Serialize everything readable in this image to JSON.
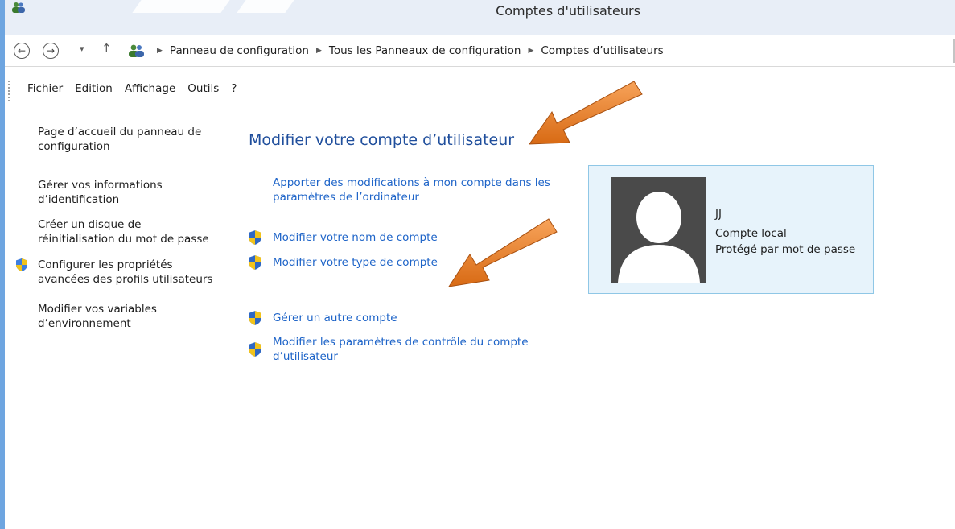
{
  "window": {
    "title": "Comptes d'utilisateurs"
  },
  "address": {
    "breadcrumbs": [
      "Panneau de configuration",
      "Tous les Panneaux de configuration",
      "Comptes d’utilisateurs"
    ]
  },
  "menu": [
    "Fichier",
    "Edition",
    "Affichage",
    "Outils",
    "?"
  ],
  "left_panel": {
    "home_line1": "Page d’accueil du panneau de",
    "home_line2": "configuration",
    "ident_line1": "Gérer vos informations",
    "ident_line2": "d’identification",
    "reset_line1": "Créer un disque de",
    "reset_line2": "réinitialisation du mot de passe",
    "profiles_line1": "Configurer les propriétés",
    "profiles_line2": "avancées des profils utilisateurs",
    "env_line1": "Modifier vos variables",
    "env_line2": "d’environnement"
  },
  "main": {
    "title": "Modifier votre compte d’utilisateur",
    "settings_line1": "Apporter des modifications à mon compte dans les",
    "settings_line2": "paramètres de l’ordinateur",
    "rename": "Modifier votre nom de compte",
    "change_type": "Modifier votre type de compte",
    "manage_other": "Gérer un autre compte",
    "uac_line1": "Modifier les paramètres de contrôle du compte",
    "uac_line2": "d’utilisateur"
  },
  "account": {
    "name": "JJ",
    "type": "Compte local",
    "protection": "Protégé par mot de passe"
  },
  "colors": {
    "link": "#1e64c8",
    "title": "#1f4e9c",
    "card_bg": "#e7f3fb",
    "card_border": "#8fc7e6",
    "arrow": "#e8781e"
  },
  "icons": [
    "back-icon",
    "forward-icon",
    "up-icon",
    "users-icon",
    "shield-icon",
    "user-avatar-icon",
    "arrow-annotation"
  ]
}
